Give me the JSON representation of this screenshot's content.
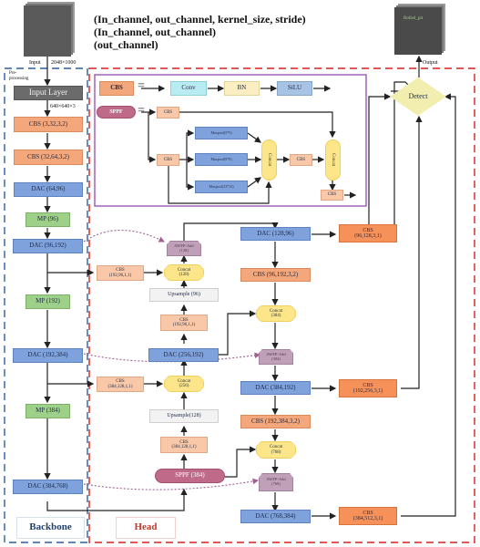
{
  "legend": {
    "line1": "(In_channel, out_channel, kernel_size, stride)",
    "line2": "(In_channel, out_channel)",
    "line3": "(out_channel)"
  },
  "input": {
    "label": "Input",
    "size": "2048×1000"
  },
  "output": {
    "label": "Output",
    "thumb_text": "Rolled_pit"
  },
  "preprocessing": "Pre-\nprocessing",
  "dims_640": "640×640×3",
  "sections": {
    "backbone": "Backbone",
    "head": "Head"
  },
  "colors": {
    "backbone_border": "#2f5f9a",
    "head_border": "#d42020",
    "module_border": "#9b59b6",
    "backbone_label": "#1f3f6e",
    "head_label": "#c0392b"
  },
  "backbone": [
    {
      "id": "input-layer",
      "label": "Input Layer"
    },
    {
      "id": "cbs-1",
      "label": "CBS (3,32,3,2)"
    },
    {
      "id": "cbs-2",
      "label": "CBS (32,64,3,2)"
    },
    {
      "id": "dac-1",
      "label": "DAC (64,96)"
    },
    {
      "id": "mp-1",
      "label": "MP (96)"
    },
    {
      "id": "dac-2",
      "label": "DAC (96,192)"
    },
    {
      "id": "mp-2",
      "label": "MP (192)"
    },
    {
      "id": "dac-3",
      "label": "DAC (192,384)"
    },
    {
      "id": "mp-3",
      "label": "MP (384)"
    },
    {
      "id": "dac-4",
      "label": "DAC (384,768)"
    }
  ],
  "cbs_def": {
    "name": "CBS",
    "eq": "=",
    "steps": [
      "Conv",
      "BN",
      "SiLU"
    ]
  },
  "sppf_def": {
    "name": "SPPF",
    "eq": "=",
    "cbs": "CBS",
    "maxpools": [
      "Maxpool(5*5)",
      "Maxpool(9*9)",
      "Maxpool(13*13)"
    ],
    "concat": "Concat"
  },
  "head_mid": {
    "awfp_128": "AWFP-Add\n(128)",
    "cbs_192_96_a": "CBS\n(192,96,1,1)",
    "concat_128": "Concat\n(128)",
    "upsample_96": "Upsample (96)",
    "cbs_192_96_b": "CBS\n(192,96,1,1)",
    "dac_256_192": "DAC (256,192)",
    "cbs_384_128_a": "CBS\n(384,128,1,1)",
    "concat_256": "Concat\n(256)",
    "upsample_128": "Upsample(128)",
    "cbs_384_128_b": "CBS\n(384,128,1,1)",
    "sppf_384": "SPPF (384)"
  },
  "head_right": {
    "dac_128_96": "DAC (128,96)",
    "cbs_96_128": "CBS\n(96,128,3,1)",
    "cbs_96_192": "CBS (96,192,3,2)",
    "concat_384": "Concat\n(384)",
    "awfp_384": "AWFP-Add\n(384)",
    "dac_384_192": "DAC (384,192)",
    "cbs_192_256": "CBS\n(192,256,3,1)",
    "cbs_192_384": "CBS (192,384,3,2)",
    "concat_768": "Concat\n(768)",
    "awfp_768": "AWFP-Add\n(768)",
    "dac_768_384": "DAC (768,384)",
    "cbs_384_512": "CBS\n(384,512,3,1)"
  },
  "detect": "Detect"
}
